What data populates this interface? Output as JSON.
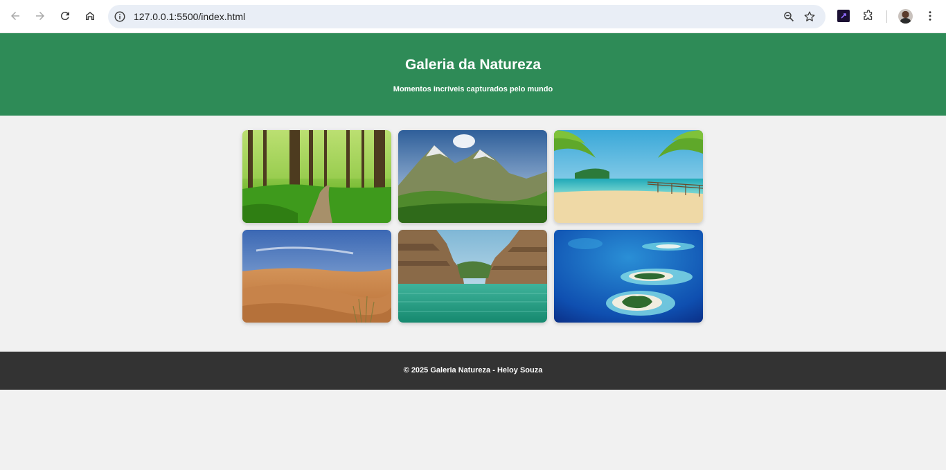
{
  "browser": {
    "url": "127.0.0.1:5500/index.html",
    "buttons": {
      "back": "back-icon",
      "forward": "forward-icon",
      "reload": "reload-icon",
      "home": "home-icon",
      "zoom": "zoom-icon",
      "bookmark": "star-icon",
      "extensions": "puzzle-icon",
      "menu": "three-dots-icon"
    }
  },
  "header": {
    "title": "Galeria da Natureza",
    "subtitle": "Momentos incríveis capturados pelo mundo",
    "background": "#2e8b57"
  },
  "gallery": {
    "images": [
      {
        "subject": "forest"
      },
      {
        "subject": "mountains"
      },
      {
        "subject": "tropical-beach"
      },
      {
        "subject": "desert"
      },
      {
        "subject": "canyon-lake"
      },
      {
        "subject": "islands"
      }
    ]
  },
  "footer": {
    "text": "© 2025 Galeria Natureza - Heloy Souza",
    "background": "#333333"
  }
}
